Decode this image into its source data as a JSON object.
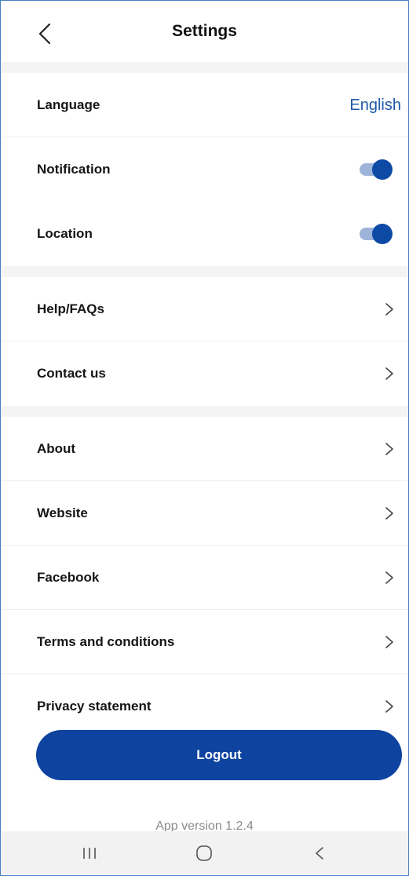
{
  "header": {
    "title": "Settings",
    "back_icon": "chevron-left-icon"
  },
  "preferences": {
    "language": {
      "label": "Language",
      "value": "English"
    },
    "notification": {
      "label": "Notification",
      "enabled": true
    },
    "location": {
      "label": "Location",
      "enabled": true
    }
  },
  "support": {
    "items": [
      {
        "label": "Help/FAQs"
      },
      {
        "label": "Contact us"
      }
    ]
  },
  "info": {
    "items": [
      {
        "label": "About"
      },
      {
        "label": "Website"
      },
      {
        "label": "Facebook"
      },
      {
        "label": "Terms and conditions"
      },
      {
        "label": "Privacy statement"
      }
    ]
  },
  "logout": {
    "label": "Logout"
  },
  "footer": {
    "version": "App version 1.2.4"
  },
  "navbar": {
    "icons": [
      "recent-apps-icon",
      "home-icon",
      "back-icon"
    ]
  },
  "colors": {
    "accent": "#0e43a0",
    "link": "#1f5aa8",
    "toggle_track": "#9eb3d9",
    "section_gap": "#f4f4f4",
    "frame_border": "#4a7fc1"
  }
}
